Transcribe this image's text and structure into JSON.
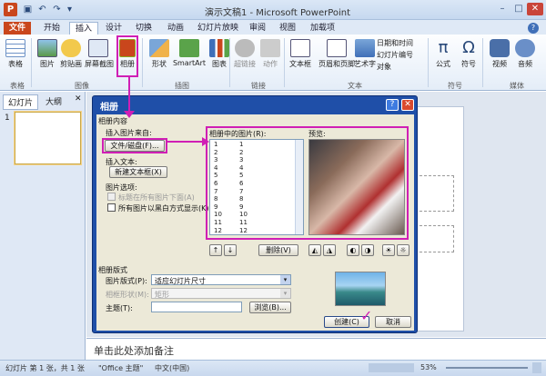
{
  "window": {
    "title": "演示文稿1 - Microsoft PowerPoint",
    "app_icon": "P"
  },
  "tabs": [
    "文件",
    "开始",
    "插入",
    "设计",
    "切换",
    "动画",
    "幻灯片放映",
    "审阅",
    "视图",
    "加载项"
  ],
  "ribbon": {
    "buttons": {
      "table": "表格",
      "picture": "图片",
      "clipart": "剪贴画",
      "screenshot": "屏幕截图",
      "album": "相册",
      "shapes": "形状",
      "smartart": "SmartArt",
      "chart": "图表",
      "hyperlink": "超链接",
      "action": "动作",
      "textbox": "文本框",
      "header_footer": "页眉和页脚",
      "wordart": "艺术字",
      "equation": "公式",
      "symbol": "符号",
      "video": "视频",
      "audio": "音频"
    },
    "small_buttons": {
      "datetime": "日期和时间",
      "slide_number": "幻灯片编号",
      "object": "对象"
    },
    "groups": {
      "tables": "表格",
      "images": "图像",
      "illustrations": "插图",
      "links": "链接",
      "text": "文本",
      "symbols": "符号",
      "media": "媒体"
    }
  },
  "left_panel": {
    "tab_slides": "幻灯片",
    "tab_outline": "大纲",
    "slide_number": "1"
  },
  "notes_placeholder": "单击此处添加备注",
  "status": {
    "slide_info": "幻灯片 第 1 张，共 1 张",
    "theme": "\"Office 主题\"",
    "language": "中文(中国)",
    "zoom": "53%"
  },
  "dialog": {
    "title": "相册",
    "content_label": "相册内容",
    "insert_from_label": "插入图片来自:",
    "file_disk_button": "文件/磁盘(F)...",
    "insert_text_label": "插入文本:",
    "new_textbox_button": "新建文本框(X)",
    "picture_options_label": "图片选项:",
    "captions_option": "标题在所有图片下面(A)",
    "blackwhite_option": "所有图片以黑白方式显示(K)",
    "pictures_in_album_label": "相册中的图片(R):",
    "pictures_left": [
      "1",
      "2",
      "3",
      "4",
      "5",
      "6",
      "7",
      "8",
      "9",
      "10",
      "11",
      "12"
    ],
    "pictures_right": [
      "1",
      "2",
      "3",
      "4",
      "5",
      "6",
      "7",
      "8",
      "9",
      "10",
      "11",
      "12"
    ],
    "preview_label": "预览:",
    "remove_button": "删除(V)",
    "layout_section": "相册版式",
    "picture_layout_label": "图片版式(P):",
    "picture_layout_value": "适应幻灯片尺寸",
    "frame_shape_label": "相框形状(M):",
    "frame_shape_value": "矩形",
    "theme_label": "主题(T):",
    "browse_button": "浏览(B)...",
    "create_button": "创建(C)",
    "cancel_button": "取消"
  }
}
